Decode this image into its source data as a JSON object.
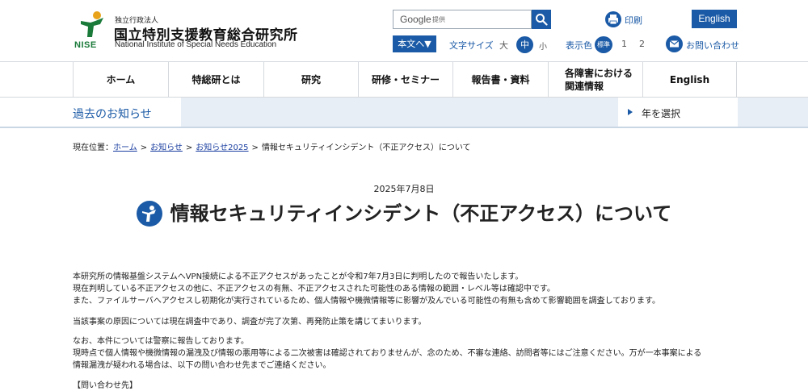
{
  "header": {
    "logo": {
      "mark_text": "NISE",
      "sub_label": "独立行政法人",
      "name_ja": "国立特別支援教育総合研究所",
      "name_en": "National Institute of Special Needs Education"
    },
    "search": {
      "engine_label": "Google",
      "provided_label": "提供"
    },
    "print_label": "印刷",
    "english_label": "English",
    "skip_to_main_label": "本文へ▼",
    "font_size": {
      "label": "文字サイズ",
      "large": "大",
      "medium": "中",
      "small": "小"
    },
    "display_color": {
      "label": "表示色",
      "standard": "標準",
      "option1": "1",
      "option2": "2"
    },
    "contact_label": "お問い合わせ"
  },
  "gnav": {
    "items": [
      {
        "label": "ホーム"
      },
      {
        "label": "特総研とは"
      },
      {
        "label": "研究"
      },
      {
        "label": "研修・セミナー"
      },
      {
        "label": "報告書・資料"
      },
      {
        "label": "各障害における\n関連情報"
      },
      {
        "label": "English"
      }
    ]
  },
  "subbar": {
    "title": "過去のお知らせ",
    "year_select_label": "年を選択"
  },
  "breadcrumb": {
    "prefix": "現在位置：",
    "items": [
      "ホーム",
      "お知らせ",
      "お知らせ2025"
    ],
    "current": "情報セキュリティインシデント（不正アクセス）について",
    "separator": ">"
  },
  "article": {
    "date": "2025年7月8日",
    "title": "情報セキュリティインシデント（不正アクセス）について",
    "paragraphs": [
      [
        "本研究所の情報基盤システムへVPN接続による不正アクセスがあったことが令和7年7月3日に判明したので報告いたします。",
        "現在判明している不正アクセスの他に、不正アクセスの有無、不正アクセスされた可能性のある情報の範囲・レベル等は確認中です。",
        "また、ファイルサーバへアクセスし初期化が実行されているため、個人情報や機微情報等に影響が及んでいる可能性の有無も含めて影響範囲を調査しております。"
      ],
      [
        "当該事案の原因については現在調査中であり、調査が完了次第、再発防止策を講じてまいります。"
      ],
      [
        "なお、本件については警察に報告しております。",
        "現時点で個人情報や機微情報の漏洩及び情報の悪用等による二次被害は確認されておりませんが、念のため、不審な連絡、訪問者等にはご注意ください。万が一本事案による",
        "情報漏洩が疑われる場合は、以下の問い合わせ先までご連絡ください。"
      ],
      [
        "【問い合わせ先】"
      ]
    ]
  },
  "colors": {
    "brand_blue": "#1b5aa6",
    "logo_green": "#1a7a3a",
    "subbar_bg": "#e7eef6"
  }
}
